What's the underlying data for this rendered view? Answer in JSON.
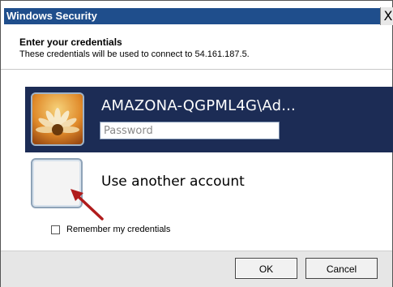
{
  "window": {
    "title": "Windows Security",
    "close_glyph": "X"
  },
  "header": {
    "title": "Enter your credentials",
    "subtitle": "These credentials will be used to connect to 54.161.187.5."
  },
  "selected_account": {
    "name": "AMAZONA-QGPML4G\\Ad...",
    "password_placeholder": "Password",
    "avatar_icon": "flower-avatar-icon"
  },
  "other_account": {
    "label": "Use another account",
    "avatar_icon": "blank-avatar-icon"
  },
  "annotation": {
    "arrow_color": "#b01c1c"
  },
  "remember": {
    "label": "Remember my credentials",
    "checked": false
  },
  "buttons": {
    "ok": "OK",
    "cancel": "Cancel"
  },
  "colors": {
    "titlebar": "#1f4e8c",
    "selected_tile": "#1c2c55",
    "footer": "#e6e6e6"
  }
}
